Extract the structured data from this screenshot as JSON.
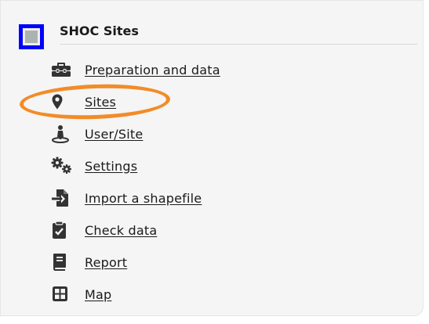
{
  "header": {
    "title": "SHOC Sites",
    "accent_color": "#0000ff"
  },
  "menu": {
    "items": [
      {
        "label": "Preparation and data",
        "icon": "toolbox-icon"
      },
      {
        "label": "Sites",
        "icon": "map-marker-icon"
      },
      {
        "label": "User/Site",
        "icon": "user-location-icon"
      },
      {
        "label": "Settings",
        "icon": "cogs-icon"
      },
      {
        "label": "Import a shapefile",
        "icon": "file-import-icon"
      },
      {
        "label": "Check data",
        "icon": "clipboard-check-icon"
      },
      {
        "label": "Report",
        "icon": "book-icon"
      },
      {
        "label": "Map",
        "icon": "grid-icon"
      }
    ]
  },
  "annotation": {
    "highlight_color": "#f28c28"
  }
}
